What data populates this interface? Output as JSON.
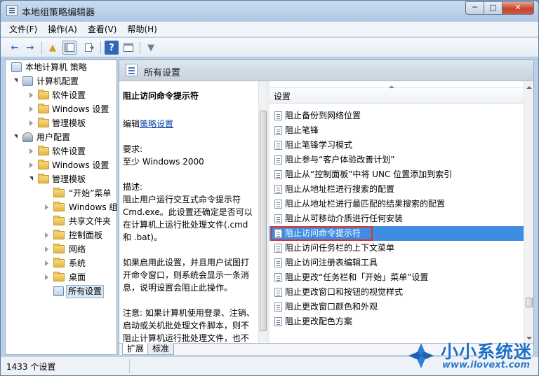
{
  "window": {
    "title": "本地组策略编辑器",
    "controls": {
      "minimize": "─",
      "maximize": "□",
      "close": "✕"
    }
  },
  "menubar": [
    {
      "label": "文件(F)"
    },
    {
      "label": "操作(A)"
    },
    {
      "label": "查看(V)"
    },
    {
      "label": "帮助(H)"
    }
  ],
  "toolbar": {
    "back_icon": "←",
    "forward_icon": "→",
    "up_icon": "▲",
    "help_icon": "?",
    "filter_icon": "▼"
  },
  "tree": [
    {
      "label": "本地计算机 策略"
    },
    {
      "label": "计算机配置"
    },
    {
      "label": "软件设置"
    },
    {
      "label": "Windows 设置"
    },
    {
      "label": "管理模板"
    },
    {
      "label": "用户配置"
    },
    {
      "label": "软件设置"
    },
    {
      "label": "Windows 设置"
    },
    {
      "label": "管理模板"
    },
    {
      "label": "“开始”菜单"
    },
    {
      "label": "Windows 组件"
    },
    {
      "label": "共享文件夹"
    },
    {
      "label": "控制面板"
    },
    {
      "label": "网络"
    },
    {
      "label": "系统"
    },
    {
      "label": "桌面"
    },
    {
      "label": "所有设置"
    }
  ],
  "main": {
    "header_title": "所有设置",
    "description": {
      "title": "阻止访问命令提示符",
      "edit_prefix": "编辑",
      "edit_link": "策略设置",
      "requirements_label": "要求:",
      "requirements_value": "至少 Windows 2000",
      "desc_label": "描述:",
      "desc_text": "阻止用户运行交互式命令提示符 Cmd.exe。此设置还确定是否可以在计算机上运行批处理文件(.cmd 和 .bat)。",
      "enabled_text": "如果启用此设置，并且用户试图打开命令窗口，则系统会显示一条消息，说明设置会阻止此操作。",
      "note_text": "注意: 如果计算机使用登录、注销、启动或关机批处理文件脚本，则不阻止计算机运行批处理文件，也不阻止使用远程桌面服务的用户"
    },
    "list_header": "设置",
    "settings": [
      {
        "label": "阻止备份到网络位置"
      },
      {
        "label": "阻止笔锋"
      },
      {
        "label": "阻止笔锋学习模式"
      },
      {
        "label": "阻止参与“客户体验改善计划”"
      },
      {
        "label": "阻止从“控制面板”中将 UNC 位置添加到索引"
      },
      {
        "label": "阻止从地址栏进行搜索的配置"
      },
      {
        "label": "阻止从地址栏进行最匹配的结果搜索的配置"
      },
      {
        "label": "阻止从可移动介质进行任何安装"
      },
      {
        "label": "阻止访问命令提示符"
      },
      {
        "label": "阻止访问任务栏的上下文菜单"
      },
      {
        "label": "阻止访问注册表编辑工具"
      },
      {
        "label": "阻止更改“任务栏和「开始」菜单”设置"
      },
      {
        "label": "阻止更改窗口和按钮的视觉样式"
      },
      {
        "label": "阻止更改窗口颜色和外观"
      },
      {
        "label": "阻止更改配色方案"
      }
    ],
    "tabs": [
      {
        "label": "扩展"
      },
      {
        "label": "标准"
      }
    ]
  },
  "status": {
    "text": "1433 个设置"
  },
  "watermark": {
    "brand": "小小系统迷",
    "url": "www.ilovext.com"
  },
  "colors": {
    "selection": "#3d8ee3",
    "highlight_box": "#e0302a",
    "link": "#0645ad"
  }
}
